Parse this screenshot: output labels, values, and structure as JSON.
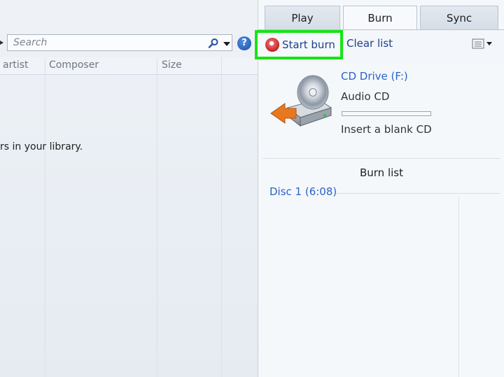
{
  "library": {
    "search_placeholder": "Search",
    "help_glyph": "?",
    "columns": [
      "artist",
      "Composer",
      "Size"
    ],
    "empty_message": "rs in your library."
  },
  "tabs": [
    {
      "label": "Play"
    },
    {
      "label": "Burn",
      "active": true
    },
    {
      "label": "Sync"
    }
  ],
  "toolbar": {
    "start_burn_label": "Start burn",
    "clear_list_label": "Clear list",
    "highlight_color": "#14e514"
  },
  "drive": {
    "name": "CD Drive (F:)",
    "media": "Audio CD",
    "progress": 0,
    "status": "Insert a blank CD"
  },
  "burn_list": {
    "title": "Burn list",
    "disc_label": "Disc 1 (6:08)"
  },
  "icons": [
    "search-icon",
    "chevron-down-icon",
    "help-icon",
    "burn-icon",
    "list-options-icon",
    "cd-drive-icon"
  ],
  "colors": {
    "link": "#2a62c8",
    "action": "#1f3f8a"
  }
}
